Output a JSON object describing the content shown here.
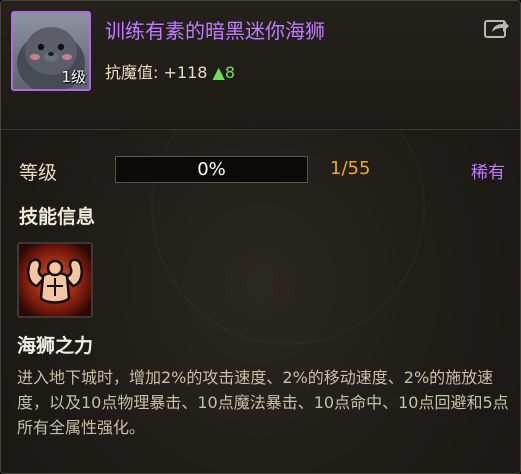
{
  "item": {
    "name": "训练有素的暗黑迷你海狮",
    "level_badge": "1级",
    "portrait_icon": "seal-portrait",
    "share_icon": "share-export-icon",
    "name_color": "#c07bff"
  },
  "stat": {
    "label": "抗魔值:",
    "value": "+118",
    "bonus": "▲8",
    "bonus_color": "#6fe05a"
  },
  "level": {
    "label": "等级",
    "progress": 0,
    "progress_text": "0%",
    "exp_text": "1/55",
    "rarity": "稀有"
  },
  "skill_section": {
    "title": "技能信息",
    "skill_icon": "flexing-strongman-icon",
    "skill_name": "海狮之力",
    "description": "进入地下城时，增加2%的攻击速度、2%的移动速度、2%的施放速度，以及10点物理暴击、10点魔法暴击、10点命中、10点回避和5点所有全属性强化。"
  }
}
